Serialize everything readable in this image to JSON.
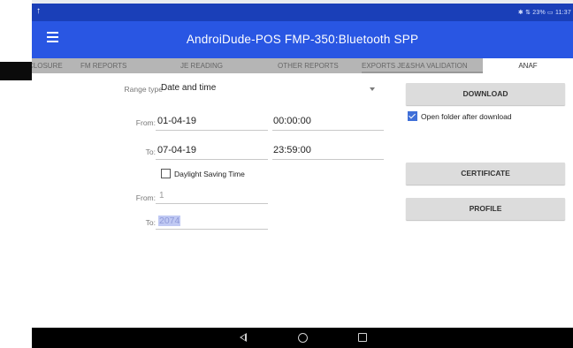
{
  "status_bar": {
    "upload_icon": "upload-arrow-icon",
    "right_text": "✱ ⇅ 23% ▭ 11:37"
  },
  "app_bar": {
    "menu_icon": "hamburger-menu-icon",
    "title": "AndroiDude-POS   FMP-350:Bluetooth SPP"
  },
  "tabs": [
    {
      "label": "CLOSURE",
      "active": false
    },
    {
      "label": "FM REPORTS",
      "active": false
    },
    {
      "label": "JE READING",
      "active": false
    },
    {
      "label": "OTHER REPORTS",
      "active": false
    },
    {
      "label": "EXPORTS JE&SHA VALIDATION",
      "active": false
    },
    {
      "label": "ANAF",
      "active": true
    }
  ],
  "form": {
    "range_type_label": "Range type",
    "range_type_value": "Date and time",
    "from_label": "From:",
    "from_date": "01-04-19",
    "from_time": "00:00:00",
    "to_label": "To:",
    "to_date": "07-04-19",
    "to_time": "23:59:00",
    "daylight_saving_label": "Daylight Saving Time",
    "daylight_saving_checked": false,
    "from2_label": "From:",
    "from2_value": "1",
    "to2_label": "To:",
    "to2_value": "2074"
  },
  "actions": {
    "download_label": "DOWNLOAD",
    "open_folder_label": "Open folder after download",
    "open_folder_checked": true,
    "certificate_label": "CERTIFICATE",
    "profile_label": "PROFILE"
  },
  "nav_bar": {
    "back_icon": "back-triangle-icon",
    "home_icon": "home-circle-icon",
    "recents_icon": "recents-square-icon"
  },
  "colors": {
    "status_bar": "#1a3fb8",
    "app_bar": "#2956e3",
    "tabs_bg": "#b5b5b5",
    "checkbox_accent": "#3f6fd8",
    "button_bg": "#dcdcdc"
  }
}
